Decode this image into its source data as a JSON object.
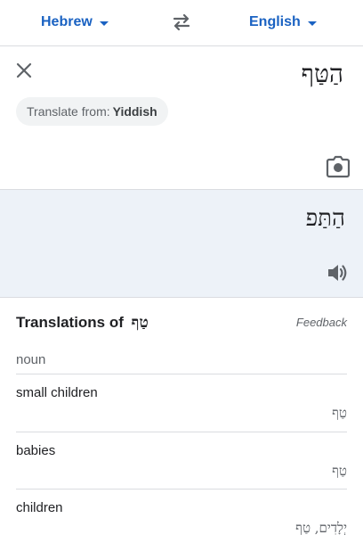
{
  "lang_bar": {
    "source_label": "Hebrew",
    "target_label": "English"
  },
  "source": {
    "text": "הַטַּף",
    "detect_prefix": "Translate from:",
    "detect_lang": "Yiddish"
  },
  "output": {
    "text": "הַתַּפ"
  },
  "dictionary": {
    "title_prefix": "Translations of",
    "title_word": "טַף",
    "feedback_label": "Feedback",
    "part_of_speech": "noun",
    "entries": [
      {
        "word": "small children",
        "reverse": "טַף"
      },
      {
        "word": "babies",
        "reverse": "טַף"
      },
      {
        "word": "children",
        "reverse": "יְלָדִים, טַף"
      }
    ]
  },
  "colors": {
    "accent": "#1a62c2",
    "output_bg": "#edf2f8",
    "divider": "#dadce0"
  },
  "icons": {
    "swap": "swap-languages-icon",
    "close": "close-icon",
    "camera": "camera-icon",
    "speaker": "speaker-icon"
  }
}
